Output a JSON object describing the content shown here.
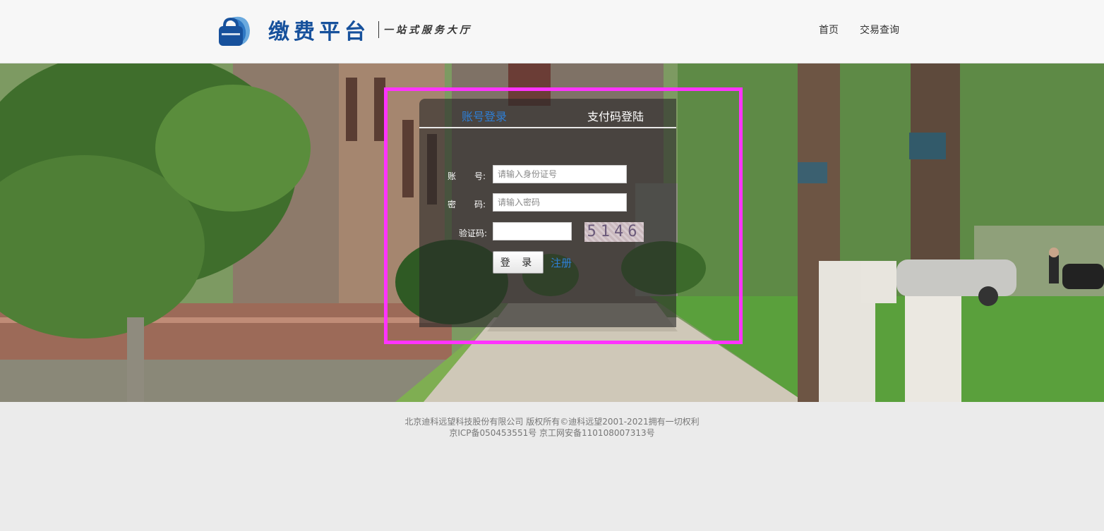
{
  "header": {
    "brand_title": "缴费平台",
    "brand_slogan": "一站式服务大厅",
    "nav": [
      {
        "label": "首页"
      },
      {
        "label": "交易查询"
      }
    ]
  },
  "login": {
    "tabs": [
      {
        "label": "账号登录",
        "active": true
      },
      {
        "label": "支付码登陆",
        "active": false
      }
    ],
    "account_label_a": "账",
    "account_label_b": "号:",
    "password_label_a": "密",
    "password_label_b": "码:",
    "captcha_label": "验证码:",
    "account_placeholder": "请输入身份证号",
    "password_placeholder": "请输入密码",
    "captcha_value": "",
    "captcha_image_text": "5146",
    "login_button": "登 录",
    "register_link": "注册"
  },
  "footer": {
    "line1": "北京迪科远望科技股份有限公司 版权所有©迪科远望2001-2021拥有一切权利",
    "line2": "京ICP备050453551号 京工网安备110108007313号"
  },
  "colors": {
    "brand": "#17519c",
    "accent_link": "#2e7fd6",
    "highlight_border": "#ff33ff"
  }
}
